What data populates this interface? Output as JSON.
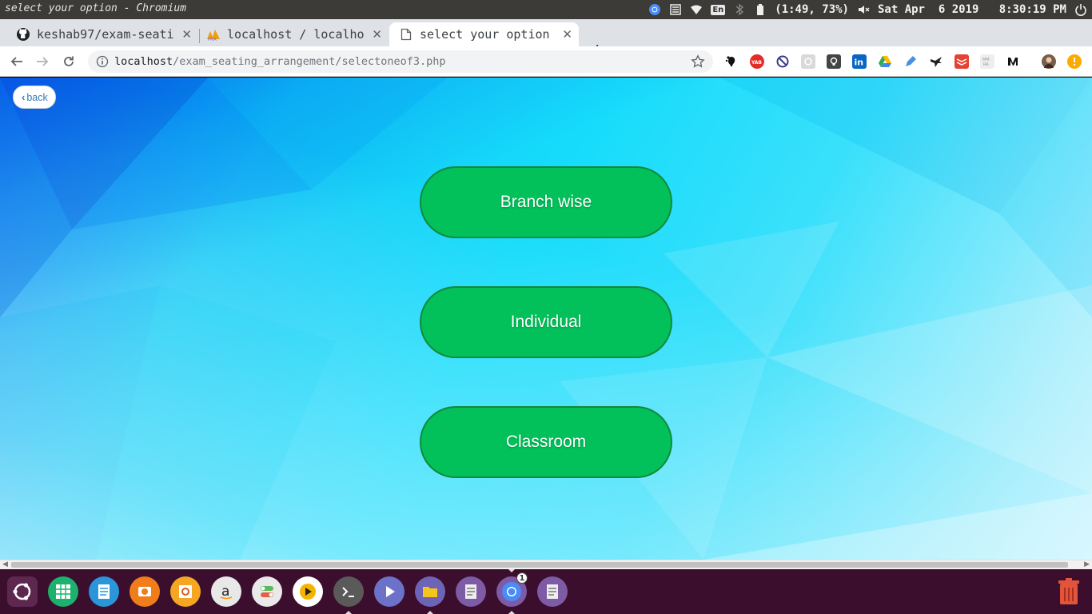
{
  "system_bar": {
    "window_title": "select your option - Chromium",
    "battery": "(1:49, 73%)",
    "keyboard_layout": "En",
    "datetime": "Sat Apr  6 2019   8:30:19 PM"
  },
  "tabs": [
    {
      "title": "keshab97/exam-seati",
      "icon": "github-icon",
      "active": false
    },
    {
      "title": "localhost / localho",
      "icon": "phpmyadmin-icon",
      "active": false
    },
    {
      "title": "select your option",
      "icon": "page-icon",
      "active": true
    }
  ],
  "address_bar": {
    "host": "localhost",
    "path": "/exam_seating_arrangement/selectoneof3.php"
  },
  "page": {
    "back_label": "back",
    "options": [
      "Branch wise",
      "Individual",
      "Classroom"
    ]
  },
  "dock": {
    "chromium_badge": "1"
  },
  "colors": {
    "option_button": "#02c15a",
    "option_border": "#118a3a",
    "dock_bg": "#3a0e2c",
    "back_link": "#337ab7"
  }
}
